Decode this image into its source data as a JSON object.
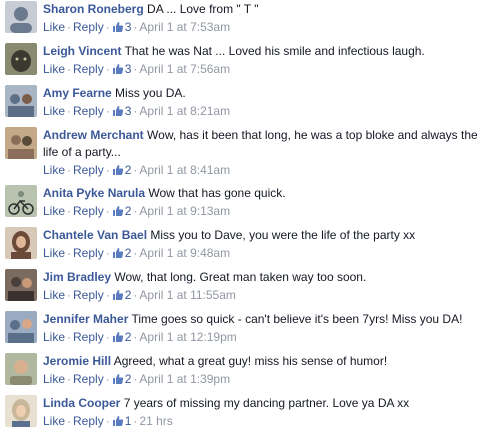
{
  "ui": {
    "like_label": "Like",
    "reply_label": "Reply",
    "separator": "·"
  },
  "comments": [
    {
      "author": "Sharon Roneberg",
      "text": "DA ... Love from \" T \"",
      "likes": "3",
      "time": "April 1 at 7:53am",
      "avatar_color": "#6b7a8f"
    },
    {
      "author": "Leigh Vincent",
      "text": "That he was Nat ... Loved his smile and infectious laugh.",
      "likes": "3",
      "time": "April 1 at 7:56am",
      "avatar_color": "#3a3a30"
    },
    {
      "author": "Amy Fearne",
      "text": "Miss you DA.",
      "likes": "3",
      "time": "April 1 at 8:21am",
      "avatar_color": "#5c6f86"
    },
    {
      "author": "Andrew Merchant",
      "text": "Wow, has it been that long, he was a top bloke and always the life of a party...",
      "likes": "2",
      "time": "April 1 at 8:41am",
      "avatar_color": "#8a6e5a"
    },
    {
      "author": "Anita Pyke Narula",
      "text": "Wow that has gone quick.",
      "likes": "2",
      "time": "April 1 at 9:13am",
      "avatar_color": "#7d8a7a"
    },
    {
      "author": "Chantele Van Bael",
      "text": "Miss you to Dave, you were the life of the party xx",
      "likes": "2",
      "time": "April 1 at 9:48am",
      "avatar_color": "#6b4a3a"
    },
    {
      "author": "Jim Bradley",
      "text": "Wow, that long. Great man taken way too soon.",
      "likes": "2",
      "time": "April 1 at 11:55am",
      "avatar_color": "#4a3f3a"
    },
    {
      "author": "Jennifer Maher",
      "text": "Time goes so quick - can't believe it's been 7yrs! Miss you DA!",
      "likes": "2",
      "time": "April 1 at 12:19pm",
      "avatar_color": "#5a6f8a"
    },
    {
      "author": "Jeromie Hill",
      "text": "Agreed, what a great guy! miss his sense of humor!",
      "likes": "2",
      "time": "April 1 at 1:39pm",
      "avatar_color": "#8a8a70"
    },
    {
      "author": "Linda Cooper",
      "text": "7 years of missing my dancing partner. Love ya DA xx",
      "likes": "1",
      "time": "21 hrs",
      "avatar_color": "#c9b79a"
    }
  ]
}
